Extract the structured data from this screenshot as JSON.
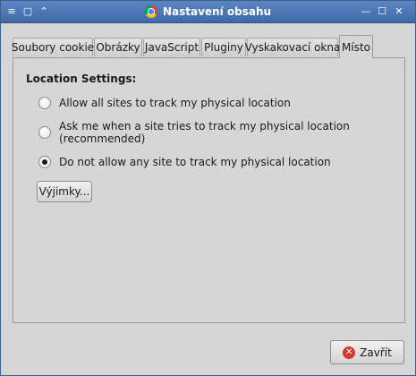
{
  "window": {
    "title": "Nastavení obsahu",
    "menu_glyph": "≡",
    "sticky_glyph": "▢",
    "shade_glyph": "⌃",
    "minimize_glyph": "—",
    "maximize_glyph": "☐",
    "close_glyph": "✕"
  },
  "tabs": [
    {
      "label": "Soubory cookie"
    },
    {
      "label": "Obrázky"
    },
    {
      "label": "JavaScript"
    },
    {
      "label": "Pluginy"
    },
    {
      "label": "Vyskakovací okna"
    },
    {
      "label": "Místo",
      "active": true
    }
  ],
  "location": {
    "section_title": "Location Settings:",
    "options": [
      {
        "label": "Allow all sites to track my physical location",
        "checked": false
      },
      {
        "label": "Ask me when a site tries to track my physical location (recommended)",
        "checked": false
      },
      {
        "label": "Do not allow any site to track my physical location",
        "checked": true
      }
    ],
    "exceptions_button": "Výjimky..."
  },
  "footer": {
    "close_button": "Zavřít",
    "close_icon_glyph": "✕"
  },
  "colors": {
    "titlebar": "#4a76b5",
    "window_bg": "#d6d6d6",
    "close_icon": "#d23a2a"
  }
}
